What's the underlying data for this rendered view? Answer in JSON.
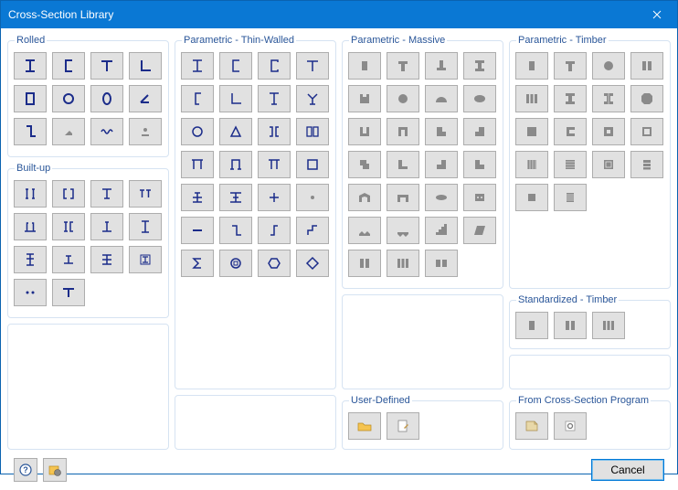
{
  "window": {
    "title": "Cross-Section Library"
  },
  "footer": {
    "cancel": "Cancel"
  },
  "groups": {
    "rolled": {
      "label": "Rolled"
    },
    "builtup": {
      "label": "Built-up"
    },
    "thin": {
      "label": "Parametric - Thin-Walled"
    },
    "massive": {
      "label": "Parametric - Massive"
    },
    "timber": {
      "label": "Parametric - Timber"
    },
    "std_timber": {
      "label": "Standardized - Timber"
    },
    "user": {
      "label": "User-Defined"
    },
    "program": {
      "label": "From Cross-Section Program"
    }
  },
  "icons": {
    "rolled": [
      "i-beam",
      "c-channel",
      "t-shape",
      "angle",
      "rect-tube",
      "round-tube",
      "oval-tube",
      "v-angle",
      "z-shape",
      "profile-solid",
      "corrugated",
      "point-solid"
    ],
    "builtup": [
      "double-i",
      "double-c",
      "t-over",
      "double-t",
      "pi",
      "i-c",
      "perp",
      "i-upright",
      "i-over-i",
      "i-short",
      "cross",
      "i-boxed",
      "dots",
      "t-wide"
    ],
    "thin": [
      "i-beam",
      "c-channel",
      "c-lipped",
      "t-shape",
      "j-shape",
      "angle",
      "i-tapered",
      "y-shape",
      "circle",
      "triangle",
      "double-bar",
      "double-rect",
      "goalpost",
      "goalpost-cap",
      "pi",
      "rect",
      "i-cross",
      "i-wide",
      "plus",
      "dot",
      "minus",
      "z-shape",
      "z-alt",
      "step",
      "sigma",
      "circle-alt",
      "hex",
      "diamond"
    ],
    "massive": [
      "rect",
      "t",
      "t-inv",
      "i-dark",
      "rect-notch",
      "circle",
      "semi",
      "ellipse",
      "u",
      "u-open",
      "step-l",
      "step-r",
      "z",
      "l",
      "step",
      "step-alt",
      "arch",
      "arch2",
      "ellipse2",
      "dots",
      "zigzag",
      "zigzag2",
      "stairs",
      "parallelogram",
      "double-rect",
      "triple-rect",
      "pair"
    ],
    "timber": [
      "rect",
      "t",
      "circ",
      "double",
      "triple",
      "i",
      "i-var",
      "octagon",
      "sq",
      "c",
      "box-open",
      "box",
      "hatch-l",
      "hatch-r",
      "hatch",
      "stack",
      "box-small",
      "hatch-box"
    ],
    "std_timber": [
      "rect",
      "double",
      "triple"
    ],
    "user": [
      "folder",
      "edit"
    ],
    "program": [
      "import",
      "gear"
    ]
  }
}
